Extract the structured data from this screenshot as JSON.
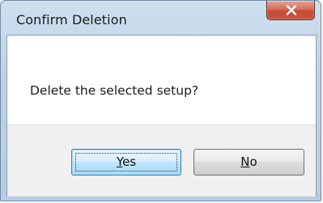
{
  "window": {
    "title": "Confirm Deletion"
  },
  "dialog": {
    "message": "Delete the selected setup?"
  },
  "buttons": {
    "yes": {
      "mnemonic": "Y",
      "rest": "es"
    },
    "no": {
      "mnemonic": "N",
      "rest": "o"
    }
  },
  "icons": {
    "close": "close-icon"
  },
  "colors": {
    "close_button": "#c9543c",
    "titlebar": "#c3d6ea",
    "focused_button_border": "#3c7fb1"
  }
}
